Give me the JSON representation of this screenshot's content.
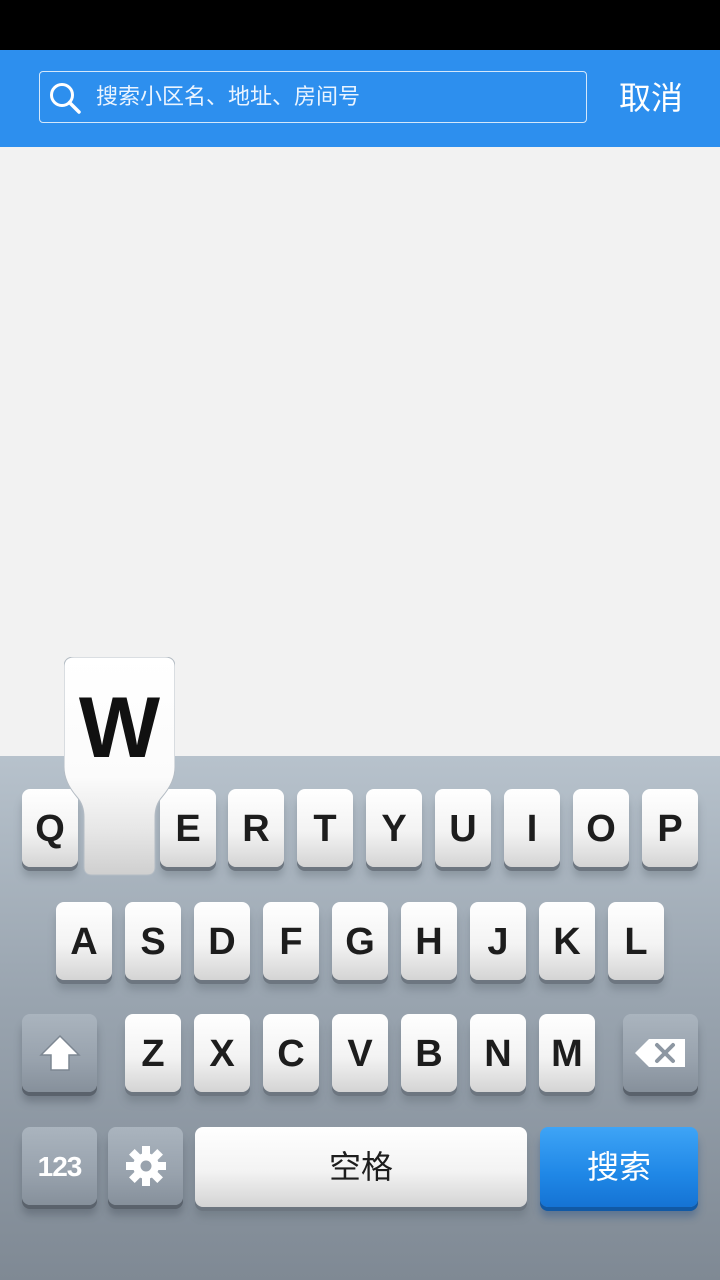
{
  "search": {
    "placeholder": "搜索小区名、地址、房间号",
    "cancel_label": "取消",
    "icon": "search-icon"
  },
  "keyboard": {
    "popup_letter": "W",
    "row1": [
      "Q",
      "W",
      "E",
      "R",
      "T",
      "Y",
      "U",
      "I",
      "O",
      "P"
    ],
    "row2": [
      "A",
      "S",
      "D",
      "F",
      "G",
      "H",
      "J",
      "K",
      "L"
    ],
    "row3": [
      "Z",
      "X",
      "C",
      "V",
      "B",
      "N",
      "M"
    ],
    "num_label": "123",
    "space_label": "空格",
    "search_label": "搜索",
    "shift_icon": "shift-icon",
    "backspace_icon": "backspace-icon",
    "settings_icon": "gear-icon"
  },
  "colors": {
    "header": "#2d8fee",
    "content_bg": "#f2f2f2",
    "search_key": "#1f87e6"
  }
}
